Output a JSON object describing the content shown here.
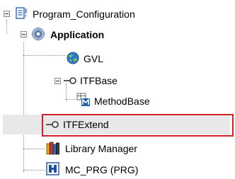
{
  "tree": {
    "root": {
      "label": "Program_Configuration",
      "icon": "project-document-icon"
    },
    "application": {
      "label": "Application",
      "icon": "gear-application-icon"
    },
    "gvl": {
      "label": "GVL",
      "icon": "globe-variable-list-icon"
    },
    "itfbase": {
      "label": "ITFBase",
      "icon": "interface-lollipop-icon"
    },
    "methodbase": {
      "label": "MethodBase",
      "icon": "method-icon"
    },
    "itfextend": {
      "label": "ITFExtend",
      "icon": "interface-lollipop-icon",
      "selected": true
    },
    "library_manager": {
      "label": "Library Manager",
      "icon": "books-icon"
    },
    "mc_prg": {
      "label": "MC_PRG (PRG)",
      "icon": "program-block-icon"
    }
  },
  "colors": {
    "highlight_border": "#d61f26",
    "selection_background": "#e8e8e8"
  }
}
